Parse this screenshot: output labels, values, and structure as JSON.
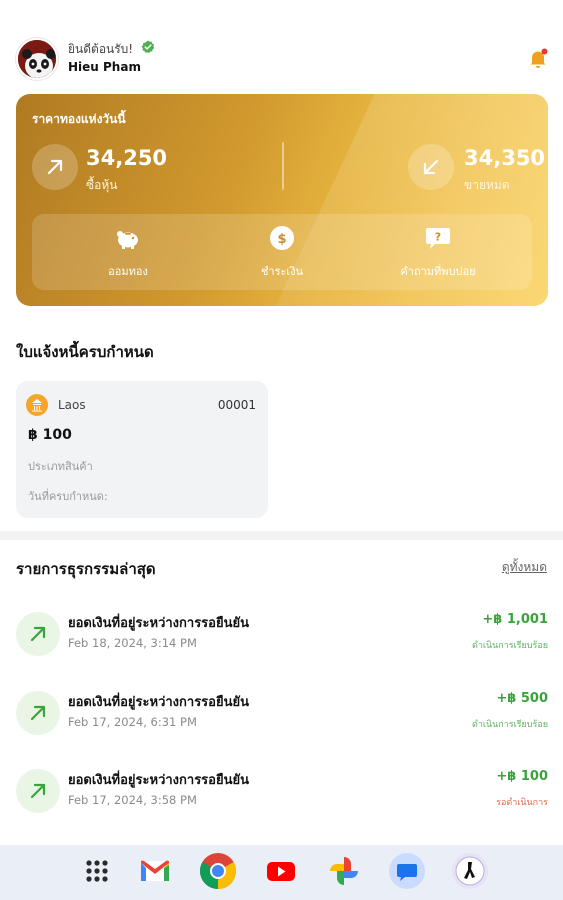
{
  "header": {
    "greeting": "ยินดีต้อนรับ!",
    "user_name": "Hieu Pham"
  },
  "gold_card": {
    "title": "ราคาทองแห่งวันนี้",
    "buy_price": "34,250",
    "buy_label": "ซื้อหุ้น",
    "sell_price": "34,350",
    "sell_label": "ขายหมด",
    "actions": [
      {
        "label": "ออมทอง",
        "icon": "piggy-bank-icon"
      },
      {
        "label": "ชำระเงิน",
        "icon": "dollar-coin-icon"
      },
      {
        "label": "คำถามที่พบบ่อย",
        "icon": "question-bubble-icon"
      }
    ]
  },
  "bills": {
    "title": "ใบแจ้งหนี้ครบกำหนด",
    "items": [
      {
        "country": "Laos",
        "code": "00001",
        "amount": "฿ 100",
        "product_type_label": "ประเภทสินค้า",
        "due_label": "วันที่ครบกำหนด:"
      }
    ]
  },
  "transactions": {
    "title": "รายการธุรกรรมล่าสุด",
    "see_all": "ดูทั้งหมด",
    "items": [
      {
        "title": "ยอดเงินที่อยู่ระหว่างการรอยืนยัน",
        "date": "Feb 18, 2024, 3:14 PM",
        "amount": "+฿ 1,001",
        "status": "ดำเนินการเรียบร้อย"
      },
      {
        "title": "ยอดเงินที่อยู่ระหว่างการรอยืนยัน",
        "date": "Feb 17, 2024, 6:31 PM",
        "amount": "+฿ 500",
        "status": "ดำเนินการเรียบร้อย"
      },
      {
        "title": "ยอดเงินที่อยู่ระหว่างการรอยืนยัน",
        "date": "Feb 17, 2024, 3:58 PM",
        "amount": "+฿ 100",
        "status": "รอดำเนินการ"
      }
    ]
  },
  "dock": {
    "apps": [
      "app-drawer-icon",
      "gmail-icon",
      "chrome-icon",
      "youtube-icon",
      "photos-icon",
      "messages-icon",
      "app-icon"
    ]
  },
  "colors": {
    "gold_dark": "#b07a22",
    "gold_light": "#fbd874",
    "positive": "#3aa33a",
    "pending": "#e06a4a",
    "bell": "#f0a020"
  }
}
